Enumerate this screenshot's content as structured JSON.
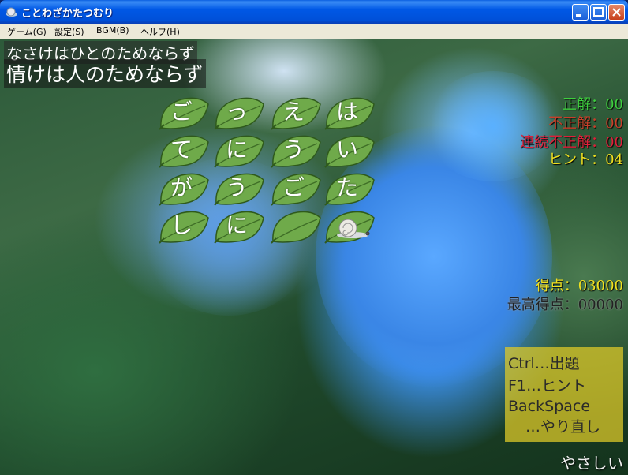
{
  "window": {
    "title": "ことわざかたつむり"
  },
  "menu": [
    "ゲーム(G)",
    "設定(S)",
    "BGM(B)",
    "ヘルプ(H)"
  ],
  "proverb": {
    "reading": "なさけはひとのためならず",
    "kanji": "情けは人のためならず"
  },
  "grid": [
    [
      "ご",
      "っ",
      "え",
      "は"
    ],
    [
      "て",
      "に",
      "う",
      "い"
    ],
    [
      "が",
      "う",
      "ご",
      "た"
    ],
    [
      "し",
      "に",
      "",
      ""
    ]
  ],
  "stats": [
    {
      "label": "正解：00",
      "color": "#3ecf3e"
    },
    {
      "label": "不正解：00",
      "color": "#c8402a"
    },
    {
      "label": "連続不正解：00",
      "color": "#e0203a"
    },
    {
      "label": "ヒント：04",
      "color": "#f0e020"
    }
  ],
  "score": {
    "label": "得点：03000",
    "color": "#f0e020"
  },
  "high_score": {
    "label": "最高得点：00000",
    "color": "#222222"
  },
  "help": {
    "line1": "Ctrl…出題",
    "line2": "F1…ヒント",
    "line3": "BackSpace",
    "line4": "…やり直し"
  },
  "difficulty": "やさしい"
}
